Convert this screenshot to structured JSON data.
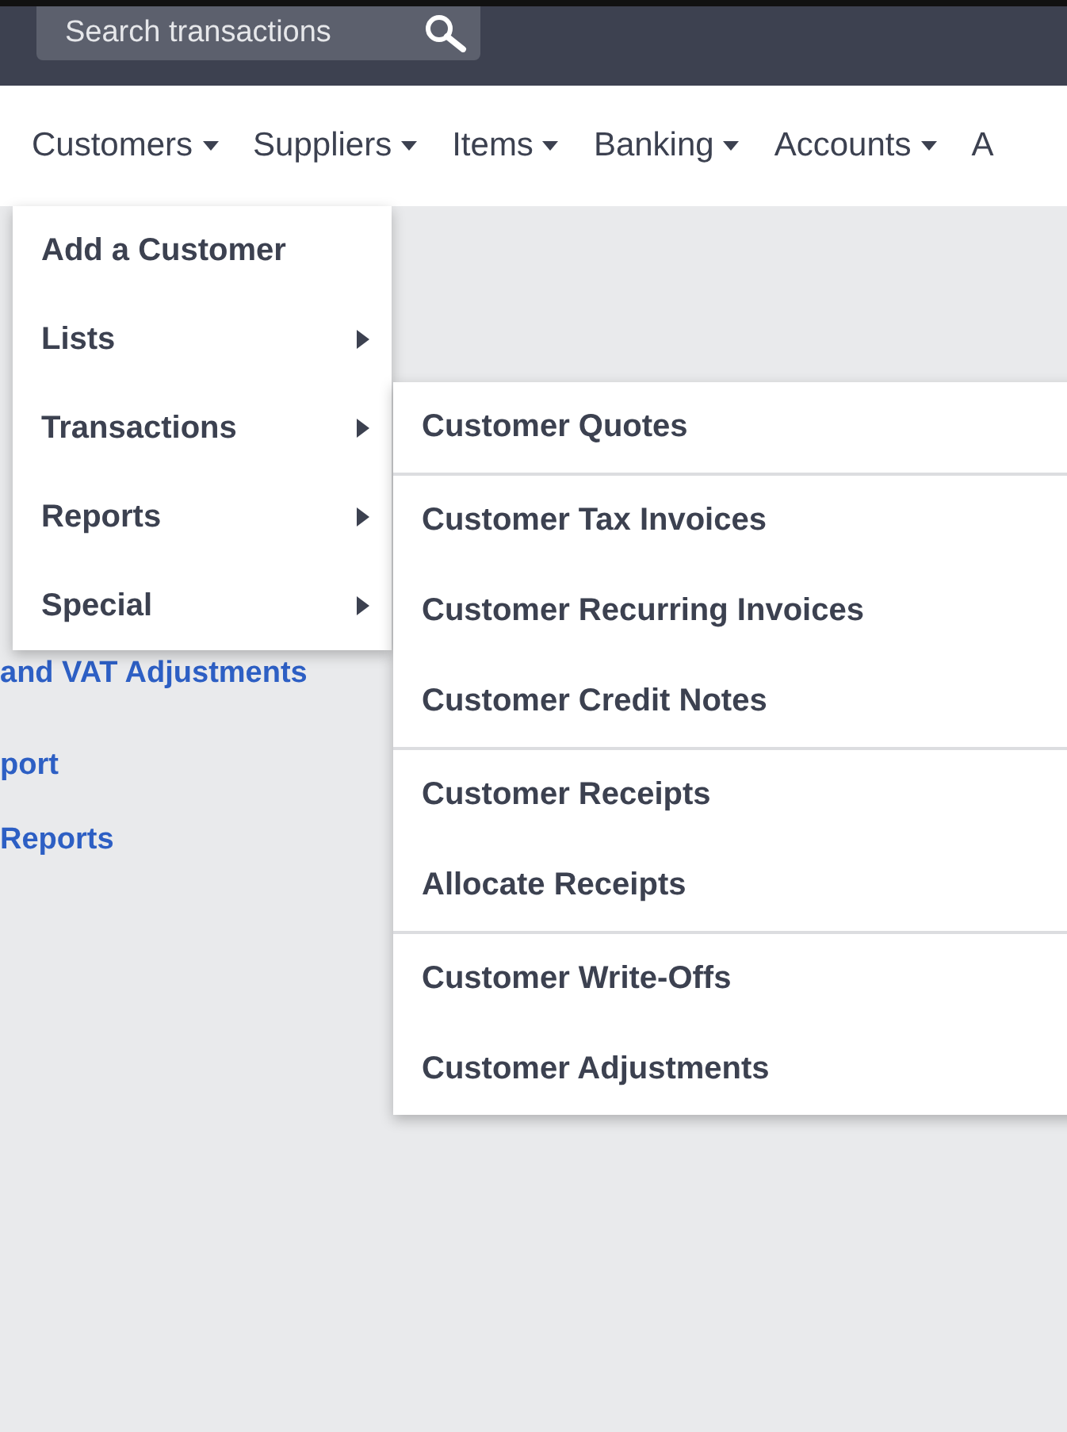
{
  "search": {
    "placeholder": "Search transactions"
  },
  "nav": [
    {
      "label": "Customers",
      "caret": true
    },
    {
      "label": "Suppliers",
      "caret": true
    },
    {
      "label": "Items",
      "caret": true
    },
    {
      "label": "Banking",
      "caret": true
    },
    {
      "label": "Accounts",
      "caret": true
    },
    {
      "label": "A",
      "caret": false
    }
  ],
  "background_links": [
    "and VAT Adjustments",
    "port",
    "Reports"
  ],
  "menu": [
    {
      "label": "Add a Customer",
      "submenu": false
    },
    {
      "label": "Lists",
      "submenu": true
    },
    {
      "label": "Transactions",
      "submenu": true
    },
    {
      "label": "Reports",
      "submenu": true
    },
    {
      "label": "Special",
      "submenu": true
    }
  ],
  "submenu": {
    "groups": [
      [
        "Customer Quotes"
      ],
      [
        "Customer Tax Invoices",
        "Customer Recurring Invoices",
        "Customer Credit Notes"
      ],
      [
        "Customer Receipts",
        "Allocate Receipts"
      ],
      [
        "Customer Write-Offs",
        "Customer Adjustments"
      ]
    ]
  }
}
